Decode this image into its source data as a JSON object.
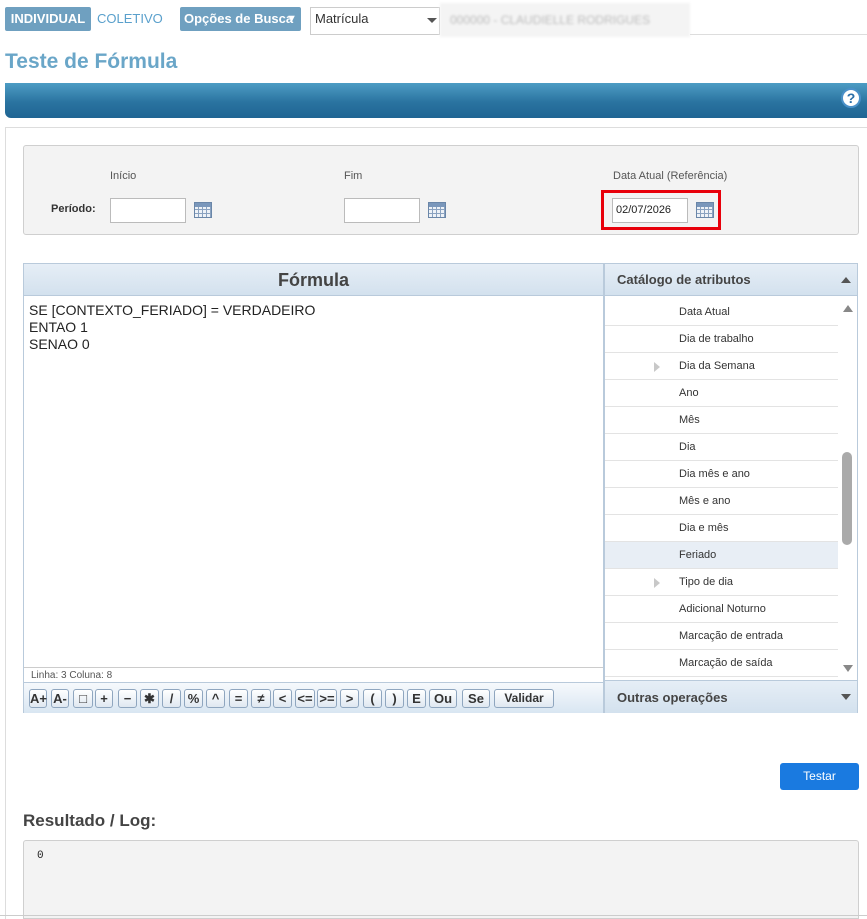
{
  "topbar": {
    "tab_individual": "INDIVIDUAL",
    "tab_coletivo": "COLETIVO",
    "search_options": "Opções de Busca",
    "search_options_caret": "▼",
    "search_type": "Matrícula",
    "employee": "000000 - CLAUDIELLE RODRIGUES"
  },
  "page": {
    "title": "Teste de Fórmula",
    "help": "?"
  },
  "period": {
    "label": "Período:",
    "start_label": "Início",
    "end_label": "Fim",
    "ref_label": "Data Atual (Referência)",
    "start_value": "",
    "end_value": "",
    "ref_value": "02/07/2026"
  },
  "formula": {
    "title": "Fórmula",
    "text": "SE [CONTEXTO_FERIADO] = VERDADEIRO\nENTAO 1\nSENAO 0",
    "status": "Linha: 3 Coluna: 8",
    "toolbar": [
      "A+",
      "A-",
      "□",
      "+",
      "−",
      "✱",
      "/",
      "%",
      "^",
      "=",
      "≠",
      "<",
      "<=",
      ">=",
      ">",
      "(",
      ")",
      "E",
      "Ou",
      "Se",
      "Validar"
    ]
  },
  "catalog": {
    "title": "Catálogo de atributos",
    "items": [
      {
        "label": "Data Atual",
        "expandable": false,
        "selected": false
      },
      {
        "label": "Dia de trabalho",
        "expandable": false,
        "selected": false
      },
      {
        "label": "Dia da Semana",
        "expandable": true,
        "selected": false
      },
      {
        "label": "Ano",
        "expandable": false,
        "selected": false
      },
      {
        "label": "Mês",
        "expandable": false,
        "selected": false
      },
      {
        "label": "Dia",
        "expandable": false,
        "selected": false
      },
      {
        "label": "Dia mês e ano",
        "expandable": false,
        "selected": false
      },
      {
        "label": "Mês e ano",
        "expandable": false,
        "selected": false
      },
      {
        "label": "Dia e mês",
        "expandable": false,
        "selected": false
      },
      {
        "label": "Feriado",
        "expandable": false,
        "selected": true
      },
      {
        "label": "Tipo de dia",
        "expandable": true,
        "selected": false
      },
      {
        "label": "Adicional Noturno",
        "expandable": false,
        "selected": false
      },
      {
        "label": "Marcação de entrada",
        "expandable": false,
        "selected": false
      },
      {
        "label": "Marcação de saída",
        "expandable": false,
        "selected": false
      }
    ],
    "other_ops": "Outras operações"
  },
  "actions": {
    "test_label": "Testar"
  },
  "result": {
    "title": "Resultado / Log:",
    "value": "0"
  },
  "colors": {
    "accent": "#6aa6c8",
    "highlight": "#e8000b",
    "button": "#1a7ae0"
  }
}
